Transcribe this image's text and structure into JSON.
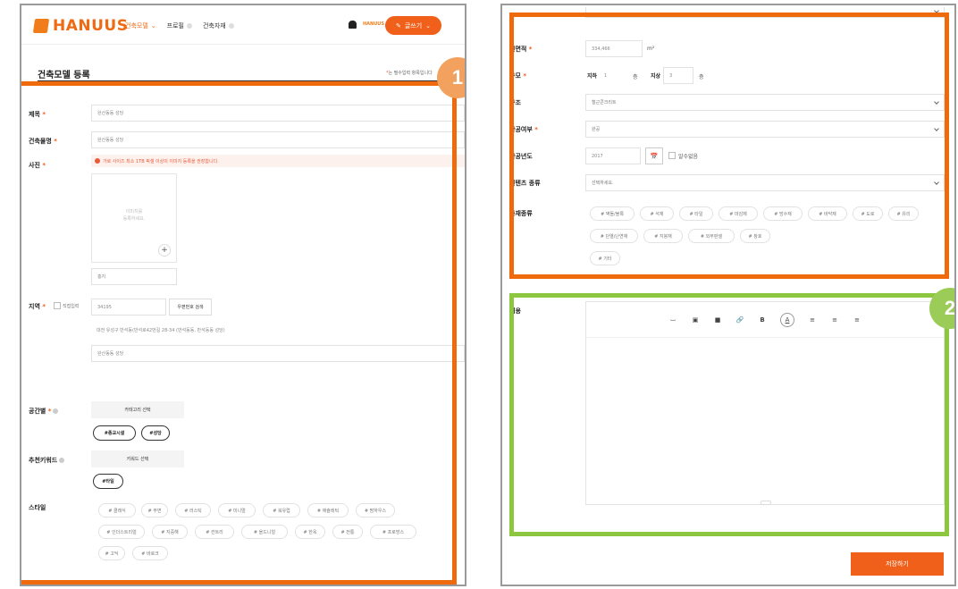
{
  "header": {
    "logo_text": "HANUUS",
    "nav": [
      {
        "label": "건축모델",
        "active": true
      },
      {
        "label": "프로필",
        "active": false
      },
      {
        "label": "건축자재",
        "active": false
      }
    ],
    "mini_logo": "HANUUS",
    "write_button": "글쓰기"
  },
  "page": {
    "title": "건축모델 등록",
    "required_note_star": "*",
    "required_note": "는 필수입력 항목입니다"
  },
  "form_left": {
    "title_label": "제목",
    "title_value": "완산동동 성당",
    "building_name_label": "건축물명",
    "building_name_value": "완산동동 성당",
    "photo_label": "사진",
    "photo_warning": "가로 사이즈 최소 1TB 픽셀 이상의 이미지 등록을 권장합니다.",
    "image_placeholder_1": "이미지를",
    "image_placeholder_2": "등록하세요.",
    "photo_caption": "홍지",
    "region_label": "지역",
    "direct_input_label": "직접입력",
    "zip_value": "34195",
    "zip_search_button": "우편번호 검색",
    "address_value": "대전 유성구 반석동(반석로42번길 28-34 (반석동동, 반석동동 성당)",
    "address_detail_value": "완산동동 성당",
    "space_label": "공간별",
    "category_select_button": "카테고리 선택",
    "space_tags": [
      "#종교시설",
      "#성당"
    ],
    "keyword_label": "추천키워드",
    "keyword_select_button": "키워드 선택",
    "keyword_tags": [
      "#타일"
    ],
    "style_label": "스타일",
    "style_tags": [
      "# 클래식",
      "# 무면",
      "# 러스틱",
      "# 미니멀",
      "# 북유럽",
      "# 애슐레턱",
      "# 팜하우스",
      "# 인더스트리얼",
      "# 지중해",
      "# 컨트리",
      "# 올드니얼",
      "# 한옥",
      "# 전통",
      "# 프로방스",
      "# 고딕",
      "# 바로크"
    ]
  },
  "form_right": {
    "area_label": "연면적",
    "area_value": "334,466",
    "area_unit": "m²",
    "scale_label": "규모",
    "underground_label": "지하",
    "underground_value": "1",
    "floor_unit": "층",
    "aboveground_label": "지상",
    "aboveground_value": "3",
    "structure_label": "구조",
    "structure_value": "철근콘크리트",
    "completion_label": "완공여부",
    "completion_value": "완공",
    "completion_year_label": "완공년도",
    "completion_year_value": "2017",
    "calendar_icon_text": "📅",
    "unknown_label": "알수없음",
    "contents_type_label": "컨텐츠 종류",
    "contents_type_value": "선택하세요.",
    "material_label": "자재종류",
    "material_tags": [
      "# 벽돌/블록",
      "# 석재",
      "# 타일",
      "# 마감재",
      "# 방수재",
      "# 바닥재",
      "# 도로",
      "# 유리",
      "# 단열/난연재",
      "# 지붕재",
      "# 외부판넬",
      "# 창호",
      "# 기타"
    ],
    "content_label": "내용",
    "toolbar": [
      "⌴",
      "▣",
      "■",
      "🔗",
      "B",
      "A",
      "≡",
      "≡",
      "≡"
    ],
    "save_button": "저장하기"
  },
  "badges": {
    "one": "1",
    "two": "2"
  },
  "colors": {
    "accent": "#f0601a",
    "highlight_orange": "#ee6a0c",
    "highlight_green": "#8dc63f"
  }
}
